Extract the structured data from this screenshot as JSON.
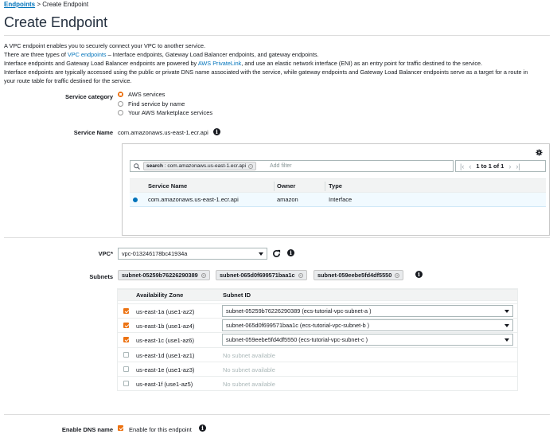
{
  "breadcrumb": {
    "parent": "Endpoints",
    "separator": ">",
    "current": "Create Endpoint"
  },
  "page_title": "Create Endpoint",
  "intro": {
    "line1": "A VPC endpoint enables you to securely connect your VPC to another service.",
    "line2_pre": "There are three types of ",
    "line2_link": "VPC endpoints",
    "line2_post": " – Interface endpoints, Gateway Load Balancer endpoints, and gateway endpoints.",
    "line3_pre": "Interface endpoints and Gateway Load Balancer endpoints are powered by ",
    "line3_link": "AWS PrivateLink",
    "line3_post": ", and use an elastic network interface (ENI) as an entry point for traffic destined to the service.",
    "line4": "Interface endpoints are typically accessed using the public or private DNS name associated with the service, while gateway endpoints and Gateway Load Balancer endpoints serve as a target for a route in",
    "line5": "your route table for traffic destined for the service."
  },
  "service_category": {
    "label": "Service category",
    "options": [
      {
        "label": "AWS services",
        "selected": true
      },
      {
        "label": "Find service by name",
        "selected": false
      },
      {
        "label": "Your AWS Marketplace services",
        "selected": false
      }
    ]
  },
  "service_name": {
    "label": "Service Name",
    "value": "com.amazonaws.us-east-1.ecr.api",
    "info_icon": "info-icon"
  },
  "service_table": {
    "search_token_key": "search",
    "search_token_value": "com.amazonaws.us-east-1.ecr.api",
    "search_placeholder": "Add filter",
    "pager_text": "1 to 1 of 1",
    "settings_icon": "gear-icon",
    "columns": [
      "Service Name",
      "Owner",
      "Type"
    ],
    "rows": [
      {
        "service_name": "com.amazonaws.us-east-1.ecr.api",
        "owner": "amazon",
        "type": "Interface",
        "selected": true
      }
    ]
  },
  "vpc": {
    "label": "VPC*",
    "value": "vpc-013246178bc41934a",
    "refresh_icon": "refresh-icon"
  },
  "subnets": {
    "label": "Subnets",
    "tokens": [
      "subnet-05259b76226290389",
      "subnet-065d0f699571baa1c",
      "subnet-059eebe5fd4df5550"
    ],
    "columns": [
      "Availability Zone",
      "Subnet ID"
    ],
    "rows": [
      {
        "az": "us-east-1a (use1-az2)",
        "checked": true,
        "subnet": "subnet-05259b76226290389 (ecs-tutorial-vpc-subnet-a )"
      },
      {
        "az": "us-east-1b (use1-az4)",
        "checked": true,
        "subnet": "subnet-065d0f699571baa1c (ecs-tutorial-vpc-subnet-b )"
      },
      {
        "az": "us-east-1c (use1-az6)",
        "checked": true,
        "subnet": "subnet-059eebe5fd4df5550 (ecs-tutorial-vpc-subnet-c )"
      },
      {
        "az": "us-east-1d (use1-az1)",
        "checked": false,
        "subnet": "No subnet available"
      },
      {
        "az": "us-east-1e (use1-az3)",
        "checked": false,
        "subnet": "No subnet available"
      },
      {
        "az": "us-east-1f (use1-az5)",
        "checked": false,
        "subnet": "No subnet available"
      }
    ]
  },
  "dns": {
    "label": "Enable DNS name",
    "checkbox_label": "Enable for this endpoint",
    "checked": true
  },
  "colors": {
    "link": "#0073bb",
    "accent": "#ec7211",
    "selected_row": "#f1faff"
  }
}
